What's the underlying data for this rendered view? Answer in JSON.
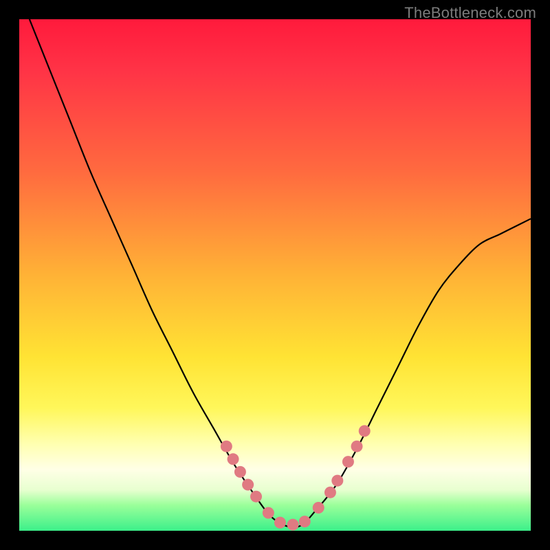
{
  "watermark": "TheBottleneck.com",
  "colors": {
    "frame": "#000000",
    "grad_top": "#ff1a3c",
    "grad_mid1": "#ff6b3f",
    "grad_mid2": "#ffe334",
    "grad_low": "#ffffe6",
    "grad_bottom": "#3cf08a",
    "curve_stroke": "#000000",
    "marker_fill": "#e07a82",
    "marker_stroke": "#d86a72"
  },
  "chart_data": {
    "type": "line",
    "title": "",
    "xlabel": "",
    "ylabel": "",
    "xlim": [
      0,
      100
    ],
    "ylim": [
      0,
      100
    ],
    "grid": false,
    "series": [
      {
        "name": "curve",
        "x": [
          2,
          6,
          10,
          14,
          18,
          22,
          26,
          30,
          34,
          38,
          42,
          46,
          49,
          52,
          55,
          58,
          62,
          66,
          70,
          74,
          78,
          82,
          86,
          90,
          94,
          98,
          100
        ],
        "y": [
          100,
          90,
          80,
          70,
          61,
          52,
          43,
          35,
          27,
          20,
          13,
          7,
          3,
          1,
          1,
          4,
          9,
          16,
          24,
          32,
          40,
          47,
          52,
          56,
          58,
          60,
          61
        ]
      }
    ],
    "markers": {
      "name": "highlight-points",
      "x": [
        40.5,
        41.8,
        43.2,
        44.7,
        46.3,
        48.7,
        51.0,
        53.5,
        55.8,
        58.5,
        60.8,
        62.2,
        64.3,
        66.0,
        67.5
      ],
      "y": [
        16.5,
        14.0,
        11.5,
        9.0,
        6.7,
        3.5,
        1.6,
        1.2,
        1.8,
        4.5,
        7.5,
        9.8,
        13.5,
        16.5,
        19.5
      ]
    }
  }
}
